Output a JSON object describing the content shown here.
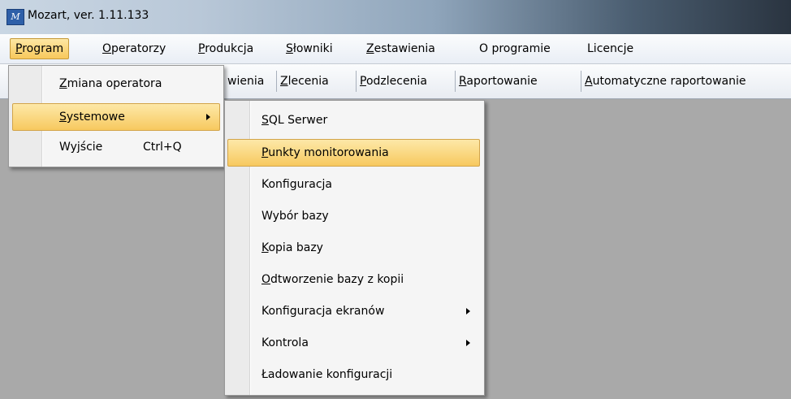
{
  "window": {
    "title": "Mozart, ver. 1.11.133",
    "icon": "mozart-app-icon"
  },
  "menubar": [
    {
      "label_u": "P",
      "label_rest": "rogram"
    },
    {
      "label_u": "O",
      "label_rest": "peratorzy"
    },
    {
      "label_u": "P",
      "label_rest": "rodukcja"
    },
    {
      "label_u": "S",
      "label_rest": "łowniki"
    },
    {
      "label_u": "Z",
      "label_rest": "estawienia"
    },
    {
      "label_u": "",
      "label_rest": "O programie"
    },
    {
      "label_u": "",
      "label_rest": "Licencje"
    }
  ],
  "tabs": [
    {
      "label_pre": "",
      "label_u": "",
      "label_rest": "wienia"
    },
    {
      "label_pre": "",
      "label_u": "Z",
      "label_rest": "lecenia"
    },
    {
      "label_pre": "",
      "label_u": "P",
      "label_rest": "odzlecenia"
    },
    {
      "label_pre": "",
      "label_u": "R",
      "label_rest": "aportowanie"
    },
    {
      "label_pre": "",
      "label_u": "A",
      "label_rest": "utomatyczne raportowanie"
    }
  ],
  "program_menu": {
    "items": [
      {
        "label_u": "Z",
        "label_rest": "miana operatora",
        "shortcut": ""
      },
      {
        "label_u": "S",
        "label_rest": "ystemowe",
        "shortcut": ""
      },
      {
        "label_u": "",
        "label_rest": "Wyjście",
        "shortcut": "Ctrl+Q"
      }
    ]
  },
  "systemowe_menu": {
    "items": [
      {
        "label_pre": "",
        "label_u": "S",
        "label_rest": "QL Serwer"
      },
      {
        "label_pre": "",
        "label_u": "P",
        "label_rest": "unkty monitorowania"
      },
      {
        "label_pre": "",
        "label_u": "",
        "label_rest": "Konfiguracja"
      },
      {
        "label_pre": "",
        "label_u": "",
        "label_rest": "Wybór bazy"
      },
      {
        "label_pre": "",
        "label_u": "K",
        "label_rest": "opia bazy"
      },
      {
        "label_pre": "",
        "label_u": "O",
        "label_rest": "dtworzenie bazy z kopii"
      },
      {
        "label_pre": "",
        "label_u": "",
        "label_rest": "Konfiguracja ekranów"
      },
      {
        "label_pre": "",
        "label_u": "",
        "label_rest": "Kontrola"
      },
      {
        "label_pre": "",
        "label_u": "",
        "label_rest": "Ładowanie konfiguracji"
      }
    ]
  },
  "colors": {
    "highlight": "#f8c85c",
    "workspace": "#a9a9a9"
  }
}
